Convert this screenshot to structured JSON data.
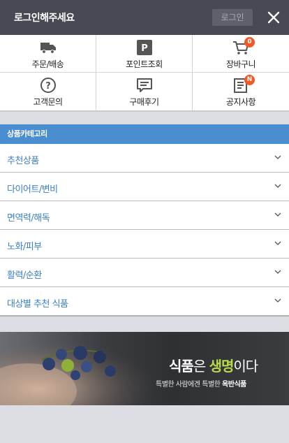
{
  "header": {
    "title": "로그인해주세요",
    "login_label": "로그인"
  },
  "quick_menu": [
    {
      "label": "주문/배송",
      "icon": "truck-icon"
    },
    {
      "label": "포인트조회",
      "icon": "point-icon",
      "icon_text": "P"
    },
    {
      "label": "장바구니",
      "icon": "cart-icon",
      "badge": "0"
    },
    {
      "label": "고객문의",
      "icon": "question-icon",
      "icon_text": "?"
    },
    {
      "label": "구매후기",
      "icon": "review-icon"
    },
    {
      "label": "공지사항",
      "icon": "notice-icon",
      "badge": "N"
    }
  ],
  "category": {
    "heading": "상품카테고리",
    "items": [
      "추천상품",
      "다이어트/변비",
      "면역력/해독",
      "노화/피부",
      "활력/순환",
      "대상별 추천 식품"
    ]
  },
  "banner": {
    "headline_a": "식품",
    "headline_b": "은 ",
    "headline_c": "생명",
    "headline_d": "이다",
    "sub_a": "특별한 사람에겐 특별한 ",
    "sub_b": "옥반식품"
  },
  "colors": {
    "header_bg": "#474a52",
    "accent_blue": "#4a8ed0",
    "badge": "#f05a28",
    "highlight_green": "#b8d84a"
  }
}
